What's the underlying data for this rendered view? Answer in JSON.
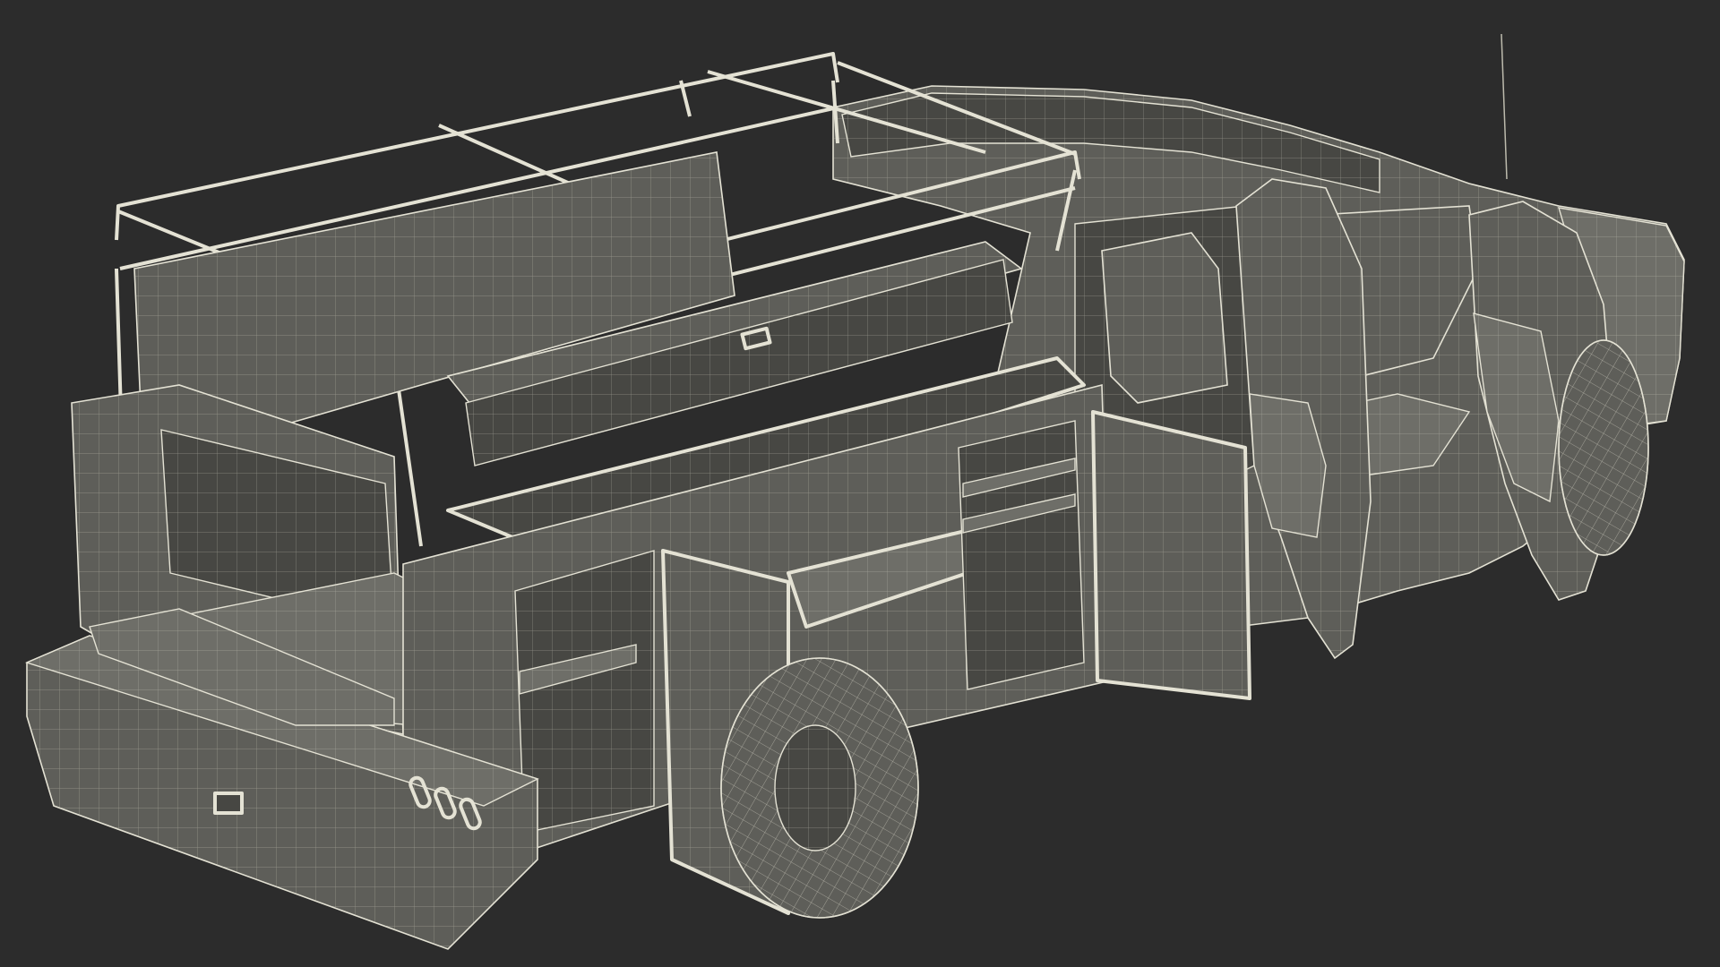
{
  "viewport": {
    "background": "#2c2c2c",
    "model_fill": "#5e5e59",
    "model_fill_dark": "#474743",
    "model_fill_light": "#6e6e68",
    "wire_color": "#e4e2d4",
    "wire_color_dim": "#bdbbad"
  },
  "model": {
    "subject_icon": "service-truck-wireframe"
  }
}
